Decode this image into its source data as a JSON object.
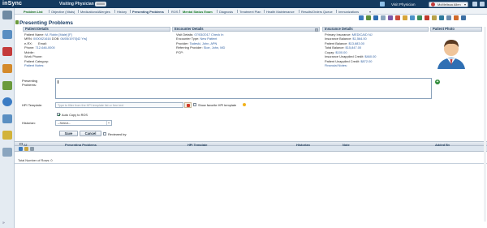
{
  "app": {
    "logo": "inSync",
    "role": "Visiting Physician",
    "role_badge": "00000",
    "visit_physician": "Visit Physician",
    "user_name": "McMelissa Allen"
  },
  "tabs": [
    {
      "label": "Problem List",
      "style": "active"
    },
    {
      "label": "Objective (Vitals)"
    },
    {
      "label": "Medications/Allergies"
    },
    {
      "label": "History"
    },
    {
      "label": "Presenting Problems",
      "style": "bold"
    },
    {
      "label": "ROS"
    },
    {
      "label": "Mental Status Exam",
      "style": "green"
    },
    {
      "label": "Diagnosis"
    },
    {
      "label": "Treatment Plan"
    },
    {
      "label": "Health Maintenance"
    },
    {
      "label": "Results/Orders Queue"
    },
    {
      "label": "Immunizations"
    }
  ],
  "page": {
    "title": "Presenting Problems"
  },
  "patient": {
    "header": "Patient Details",
    "name_label": "Patient Name:",
    "name_value": "M, Robin [Male] [F]",
    "mrn_label": "MRN:",
    "mrn_value": "0000021616",
    "dob_label": "DOB:",
    "dob_value": "06/05/1970[42 Yrs]",
    "erx_label": "e-RX:",
    "email_label": "Email:",
    "phone_label": "Phone:",
    "phone_value": "712-646-0000",
    "mobile_label": "Mobile:",
    "work_label": "Work Phone:",
    "category_label": "Patient Category:",
    "notes": "Patient Notes:"
  },
  "encounter": {
    "header": "Encounter Details",
    "visit_label": "Visit Details:",
    "visit_value": "07/03/2017",
    "visit_link": "Check In",
    "type_label": "Encounter Type:",
    "type_value": "New Patient",
    "provider_label": "Provider:",
    "provider_value": "Tadeski, John, APN",
    "ref_label": "Referring Provider:",
    "ref_value": "Sloe, John, MD",
    "pcp_label": "PCP:"
  },
  "insurance": {
    "header": "Insurance Details",
    "primary_label": "Primary Insurance:",
    "primary_value": "MEDICAID NJ",
    "ins_bal_label": "Insurance Balance:",
    "ins_bal_value": "$1,564.00",
    "pat_bal_label": "Patient Balance:",
    "pat_bal_value": "$13,683.00",
    "total_label": "Total Balance:",
    "total_value": "$15,847.00",
    "copay_label": "Copay:",
    "copay_value": "$100.00",
    "unapplied_label": "Insurance Unapplied Credit:",
    "unapplied_value": "$460.00",
    "pat_unapplied_label": "Patient Unapplied Credit:",
    "pat_unapplied_value": "$872.00",
    "notes": "Financial Notes:"
  },
  "photo": {
    "header": "Patient Photo"
  },
  "form": {
    "presenting_label_1": "Presenting",
    "presenting_label_2": "Problems:",
    "hpi_label": "HPI Template:",
    "hpi_placeholder": "Type to filter from the HPI template list or free text",
    "show_fav": "Show favorite HPI template",
    "auto_copy": "Auto Copy to ROS",
    "historian_label": "Historian:",
    "historian_value": "--Select--",
    "save": "Save",
    "cancel": "Cancel",
    "reviewed_by": "Reviewed by:"
  },
  "grid": {
    "columns": [
      "All",
      "Presenting Problems",
      "HPI Template",
      "Historian",
      "Note",
      "Added By"
    ],
    "total_rows": "Total Number of Rows: 0"
  },
  "colors": {
    "topbar": "#143a5f",
    "accent_green": "#137a24",
    "link_blue": "#2f5fa0"
  }
}
